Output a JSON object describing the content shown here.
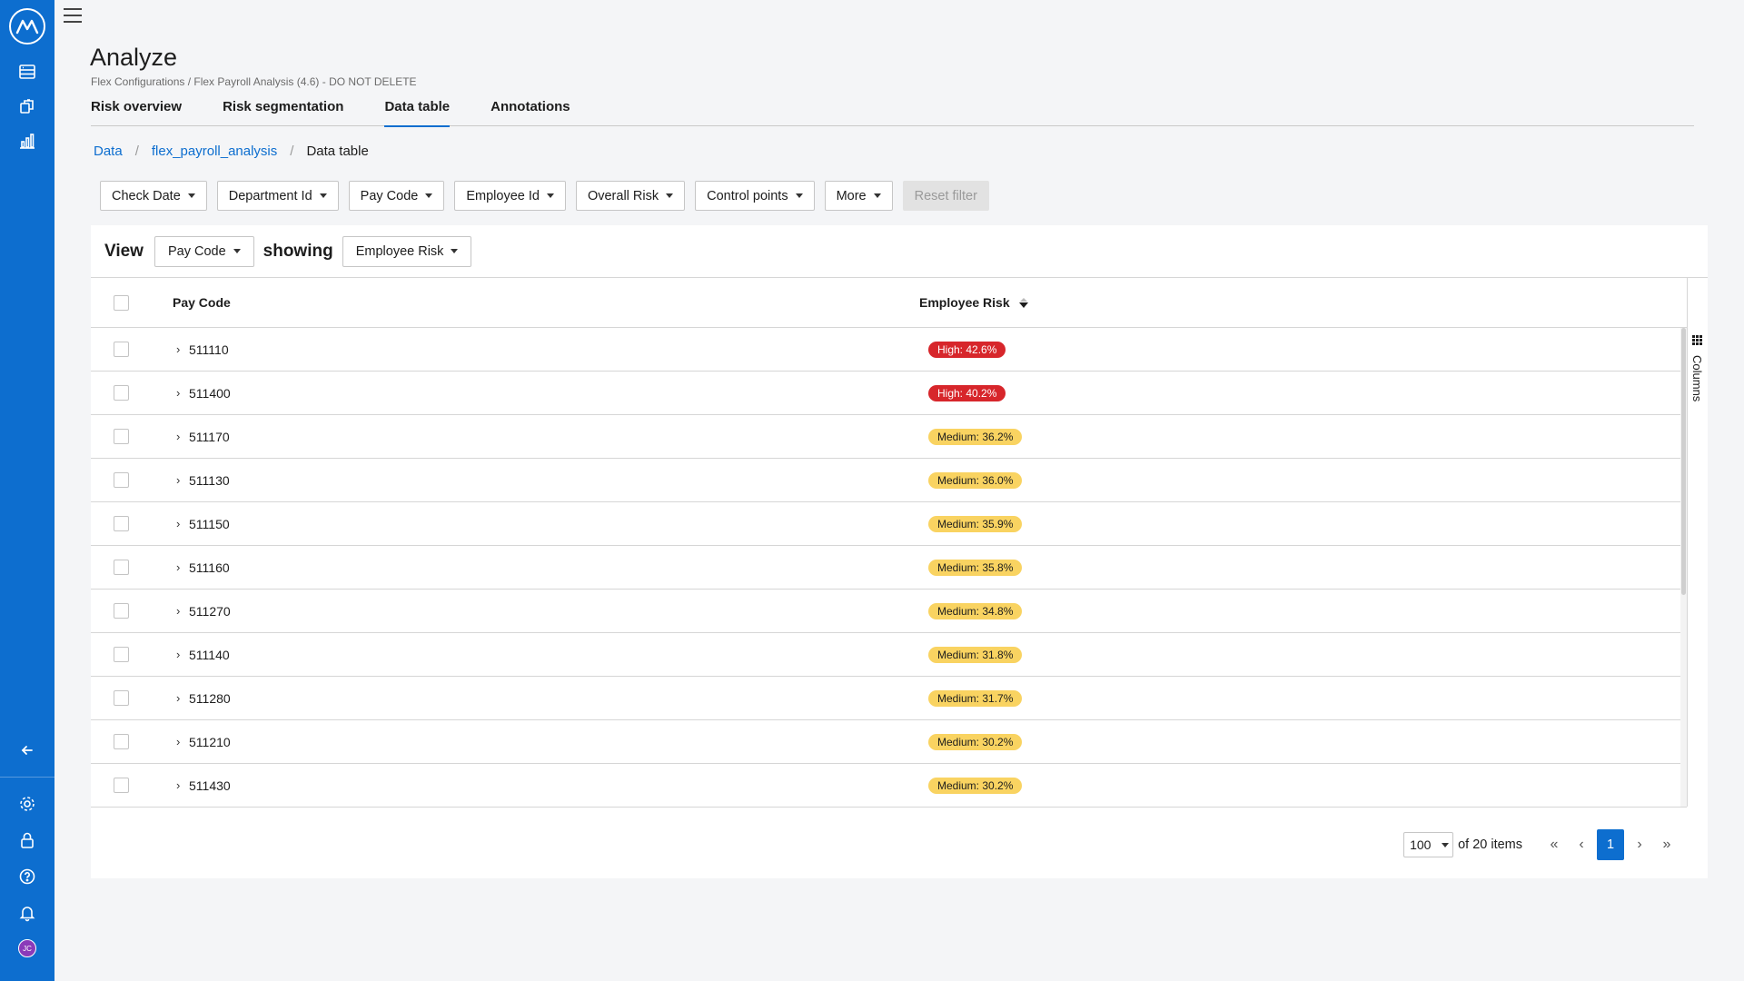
{
  "sidebar": {
    "items": [
      {
        "icon": "data-icon"
      },
      {
        "icon": "configurations-icon"
      },
      {
        "icon": "analytics-icon"
      }
    ],
    "bottom": [
      {
        "icon": "collapse-arrow-icon"
      },
      {
        "icon": "settings-gear-icon"
      },
      {
        "icon": "lock-icon"
      },
      {
        "icon": "help-icon"
      },
      {
        "icon": "notifications-bell-icon"
      }
    ],
    "avatar_initials": "JC"
  },
  "header": {
    "title": "Analyze",
    "subtitle": "Flex Configurations / Flex Payroll Analysis (4.6) - DO NOT DELETE"
  },
  "tabs": [
    {
      "label": "Risk overview",
      "active": false
    },
    {
      "label": "Risk segmentation",
      "active": false
    },
    {
      "label": "Data table",
      "active": true
    },
    {
      "label": "Annotations",
      "active": false
    }
  ],
  "breadcrumb": {
    "items": [
      "Data",
      "flex_payroll_analysis"
    ],
    "current": "Data table"
  },
  "filters": {
    "buttons": [
      "Check Date",
      "Department Id",
      "Pay Code",
      "Employee Id",
      "Overall Risk",
      "Control points",
      "More"
    ],
    "reset_label": "Reset filter"
  },
  "view": {
    "view_label": "View",
    "view_value": "Pay Code",
    "showing_label": "showing",
    "showing_value": "Employee Risk"
  },
  "table": {
    "columns": [
      "Pay Code",
      "Employee Risk"
    ],
    "rows": [
      {
        "code": "511110",
        "risk": "High: 42.6%",
        "level": "high"
      },
      {
        "code": "511400",
        "risk": "High: 40.2%",
        "level": "high"
      },
      {
        "code": "511170",
        "risk": "Medium: 36.2%",
        "level": "medium"
      },
      {
        "code": "511130",
        "risk": "Medium: 36.0%",
        "level": "medium"
      },
      {
        "code": "511150",
        "risk": "Medium: 35.9%",
        "level": "medium"
      },
      {
        "code": "511160",
        "risk": "Medium: 35.8%",
        "level": "medium"
      },
      {
        "code": "511270",
        "risk": "Medium: 34.8%",
        "level": "medium"
      },
      {
        "code": "511140",
        "risk": "Medium: 31.8%",
        "level": "medium"
      },
      {
        "code": "511280",
        "risk": "Medium: 31.7%",
        "level": "medium"
      },
      {
        "code": "511210",
        "risk": "Medium: 30.2%",
        "level": "medium"
      },
      {
        "code": "511430",
        "risk": "Medium: 30.2%",
        "level": "medium"
      }
    ],
    "columns_panel_label": "Columns"
  },
  "pager": {
    "page_size": "100",
    "total_label": "of 20 items",
    "current_page": "1"
  },
  "colors": {
    "brand": "#0d6ecf",
    "high": "#d7262b",
    "medium": "#f9d361"
  }
}
